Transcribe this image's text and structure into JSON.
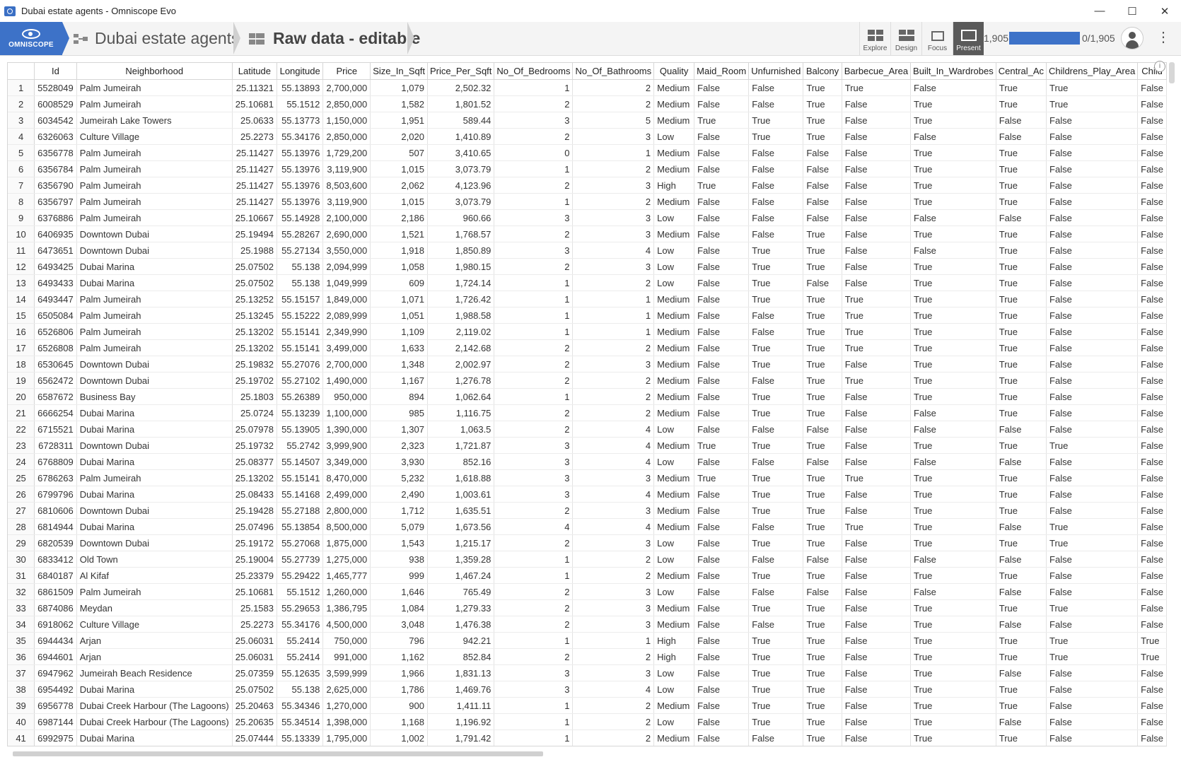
{
  "window": {
    "title": "Dubai estate agents - Omniscope Evo",
    "minimize": "—",
    "maximize": "☐",
    "close": "✕"
  },
  "toolbar": {
    "logo_label": "OMNISCOPE",
    "breadcrumb_project": "Dubai estate agents",
    "breadcrumb_view": "Raw data - editable",
    "modes": [
      "Explore",
      "Design",
      "Focus",
      "Present"
    ],
    "active_mode": "Present",
    "record_count_left": "1,905",
    "progress_fraction": 1.0,
    "record_count_right": "0/1,905",
    "accent_color": "#3d72c8"
  },
  "table": {
    "columns": [
      "Id",
      "Neighborhood",
      "Latitude",
      "Longitude",
      "Price",
      "Size_In_Sqft",
      "Price_Per_Sqft",
      "No_Of_Bedrooms",
      "No_Of_Bathrooms",
      "Quality",
      "Maid_Room",
      "Unfurnished",
      "Balcony",
      "Barbecue_Area",
      "Built_In_Wardrobes",
      "Central_Ac",
      "Childrens_Play_Area",
      "Child"
    ],
    "rows": [
      [
        "1",
        "5528049",
        "Palm Jumeirah",
        "25.11321",
        "55.13893",
        "2,700,000",
        "1,079",
        "2,502.32",
        "1",
        "2",
        "Medium",
        "False",
        "False",
        "True",
        "True",
        "False",
        "True",
        "True",
        "False"
      ],
      [
        "2",
        "6008529",
        "Palm Jumeirah",
        "25.10681",
        "55.1512",
        "2,850,000",
        "1,582",
        "1,801.52",
        "2",
        "2",
        "Medium",
        "False",
        "False",
        "True",
        "False",
        "True",
        "True",
        "True",
        "False"
      ],
      [
        "3",
        "6034542",
        "Jumeirah Lake Towers",
        "25.0633",
        "55.13773",
        "1,150,000",
        "1,951",
        "589.44",
        "3",
        "5",
        "Medium",
        "True",
        "True",
        "True",
        "False",
        "True",
        "False",
        "False",
        "False"
      ],
      [
        "4",
        "6326063",
        "Culture Village",
        "25.2273",
        "55.34176",
        "2,850,000",
        "2,020",
        "1,410.89",
        "2",
        "3",
        "Low",
        "False",
        "True",
        "True",
        "False",
        "False",
        "False",
        "False",
        "False"
      ],
      [
        "5",
        "6356778",
        "Palm Jumeirah",
        "25.11427",
        "55.13976",
        "1,729,200",
        "507",
        "3,410.65",
        "0",
        "1",
        "Medium",
        "False",
        "False",
        "False",
        "False",
        "True",
        "True",
        "False",
        "False"
      ],
      [
        "6",
        "6356784",
        "Palm Jumeirah",
        "25.11427",
        "55.13976",
        "3,119,900",
        "1,015",
        "3,073.79",
        "1",
        "2",
        "Medium",
        "False",
        "False",
        "False",
        "False",
        "True",
        "True",
        "False",
        "False"
      ],
      [
        "7",
        "6356790",
        "Palm Jumeirah",
        "25.11427",
        "55.13976",
        "8,503,600",
        "2,062",
        "4,123.96",
        "2",
        "3",
        "High",
        "True",
        "False",
        "False",
        "False",
        "True",
        "True",
        "False",
        "False"
      ],
      [
        "8",
        "6356797",
        "Palm Jumeirah",
        "25.11427",
        "55.13976",
        "3,119,900",
        "1,015",
        "3,073.79",
        "1",
        "2",
        "Medium",
        "False",
        "False",
        "False",
        "False",
        "True",
        "True",
        "False",
        "False"
      ],
      [
        "9",
        "6376886",
        "Palm Jumeirah",
        "25.10667",
        "55.14928",
        "2,100,000",
        "2,186",
        "960.66",
        "3",
        "3",
        "Low",
        "False",
        "False",
        "False",
        "False",
        "False",
        "False",
        "False",
        "False"
      ],
      [
        "10",
        "6406935",
        "Downtown Dubai",
        "25.19494",
        "55.28267",
        "2,690,000",
        "1,521",
        "1,768.57",
        "2",
        "3",
        "Medium",
        "False",
        "False",
        "True",
        "False",
        "True",
        "True",
        "False",
        "False"
      ],
      [
        "11",
        "6473651",
        "Downtown Dubai",
        "25.1988",
        "55.27134",
        "3,550,000",
        "1,918",
        "1,850.89",
        "3",
        "4",
        "Low",
        "False",
        "True",
        "True",
        "False",
        "False",
        "True",
        "False",
        "False"
      ],
      [
        "12",
        "6493425",
        "Dubai Marina",
        "25.07502",
        "55.138",
        "2,094,999",
        "1,058",
        "1,980.15",
        "2",
        "3",
        "Low",
        "False",
        "True",
        "True",
        "False",
        "True",
        "True",
        "False",
        "False"
      ],
      [
        "13",
        "6493433",
        "Dubai Marina",
        "25.07502",
        "55.138",
        "1,049,999",
        "609",
        "1,724.14",
        "1",
        "2",
        "Low",
        "False",
        "True",
        "False",
        "False",
        "True",
        "True",
        "False",
        "False"
      ],
      [
        "14",
        "6493447",
        "Palm Jumeirah",
        "25.13252",
        "55.15157",
        "1,849,000",
        "1,071",
        "1,726.42",
        "1",
        "1",
        "Medium",
        "False",
        "True",
        "True",
        "True",
        "True",
        "True",
        "False",
        "False"
      ],
      [
        "15",
        "6505084",
        "Palm Jumeirah",
        "25.13245",
        "55.15222",
        "2,089,999",
        "1,051",
        "1,988.58",
        "1",
        "1",
        "Medium",
        "False",
        "False",
        "True",
        "True",
        "True",
        "True",
        "False",
        "False"
      ],
      [
        "16",
        "6526806",
        "Palm Jumeirah",
        "25.13202",
        "55.15141",
        "2,349,990",
        "1,109",
        "2,119.02",
        "1",
        "1",
        "Medium",
        "False",
        "False",
        "True",
        "True",
        "True",
        "True",
        "False",
        "False"
      ],
      [
        "17",
        "6526808",
        "Palm Jumeirah",
        "25.13202",
        "55.15141",
        "3,499,000",
        "1,633",
        "2,142.68",
        "2",
        "2",
        "Medium",
        "False",
        "True",
        "True",
        "True",
        "True",
        "True",
        "False",
        "False"
      ],
      [
        "18",
        "6530645",
        "Downtown Dubai",
        "25.19832",
        "55.27076",
        "2,700,000",
        "1,348",
        "2,002.97",
        "2",
        "3",
        "Medium",
        "False",
        "True",
        "True",
        "False",
        "True",
        "True",
        "False",
        "False"
      ],
      [
        "19",
        "6562472",
        "Downtown Dubai",
        "25.19702",
        "55.27102",
        "1,490,000",
        "1,167",
        "1,276.78",
        "2",
        "2",
        "Medium",
        "False",
        "False",
        "True",
        "True",
        "True",
        "True",
        "False",
        "False"
      ],
      [
        "20",
        "6587672",
        "Business Bay",
        "25.1803",
        "55.26389",
        "950,000",
        "894",
        "1,062.64",
        "1",
        "2",
        "Medium",
        "False",
        "True",
        "True",
        "False",
        "True",
        "True",
        "False",
        "False"
      ],
      [
        "21",
        "6666254",
        "Dubai Marina",
        "25.0724",
        "55.13239",
        "1,100,000",
        "985",
        "1,116.75",
        "2",
        "2",
        "Medium",
        "False",
        "True",
        "True",
        "False",
        "False",
        "True",
        "False",
        "False"
      ],
      [
        "22",
        "6715521",
        "Dubai Marina",
        "25.07978",
        "55.13905",
        "1,390,000",
        "1,307",
        "1,063.5",
        "2",
        "4",
        "Low",
        "False",
        "False",
        "False",
        "False",
        "False",
        "False",
        "False",
        "False"
      ],
      [
        "23",
        "6728311",
        "Downtown Dubai",
        "25.19732",
        "55.2742",
        "3,999,900",
        "2,323",
        "1,721.87",
        "3",
        "4",
        "Medium",
        "True",
        "True",
        "True",
        "False",
        "True",
        "True",
        "True",
        "False"
      ],
      [
        "24",
        "6768809",
        "Dubai Marina",
        "25.08377",
        "55.14507",
        "3,349,000",
        "3,930",
        "852.16",
        "3",
        "4",
        "Low",
        "False",
        "False",
        "False",
        "False",
        "False",
        "False",
        "False",
        "False"
      ],
      [
        "25",
        "6786263",
        "Palm Jumeirah",
        "25.13202",
        "55.15141",
        "8,470,000",
        "5,232",
        "1,618.88",
        "3",
        "3",
        "Medium",
        "True",
        "True",
        "True",
        "True",
        "True",
        "True",
        "False",
        "False"
      ],
      [
        "26",
        "6799796",
        "Dubai Marina",
        "25.08433",
        "55.14168",
        "2,499,000",
        "2,490",
        "1,003.61",
        "3",
        "4",
        "Medium",
        "False",
        "True",
        "True",
        "False",
        "True",
        "True",
        "False",
        "False"
      ],
      [
        "27",
        "6810606",
        "Downtown Dubai",
        "25.19428",
        "55.27188",
        "2,800,000",
        "1,712",
        "1,635.51",
        "2",
        "3",
        "Medium",
        "False",
        "True",
        "True",
        "False",
        "True",
        "True",
        "False",
        "False"
      ],
      [
        "28",
        "6814944",
        "Dubai Marina",
        "25.07496",
        "55.13854",
        "8,500,000",
        "5,079",
        "1,673.56",
        "4",
        "4",
        "Medium",
        "False",
        "False",
        "True",
        "True",
        "True",
        "False",
        "True",
        "False"
      ],
      [
        "29",
        "6820539",
        "Downtown Dubai",
        "25.19172",
        "55.27068",
        "1,875,000",
        "1,543",
        "1,215.17",
        "2",
        "3",
        "Low",
        "False",
        "True",
        "True",
        "False",
        "True",
        "True",
        "True",
        "False"
      ],
      [
        "30",
        "6833412",
        "Old Town",
        "25.19004",
        "55.27739",
        "1,275,000",
        "938",
        "1,359.28",
        "1",
        "2",
        "Low",
        "False",
        "False",
        "False",
        "False",
        "False",
        "False",
        "False",
        "False"
      ],
      [
        "31",
        "6840187",
        "Al Kifaf",
        "25.23379",
        "55.29422",
        "1,465,777",
        "999",
        "1,467.24",
        "1",
        "2",
        "Medium",
        "False",
        "True",
        "True",
        "False",
        "True",
        "True",
        "False",
        "False"
      ],
      [
        "32",
        "6861509",
        "Palm Jumeirah",
        "25.10681",
        "55.1512",
        "1,260,000",
        "1,646",
        "765.49",
        "2",
        "3",
        "Low",
        "False",
        "False",
        "False",
        "False",
        "False",
        "False",
        "False",
        "False"
      ],
      [
        "33",
        "6874086",
        "Meydan",
        "25.1583",
        "55.29653",
        "1,386,795",
        "1,084",
        "1,279.33",
        "2",
        "3",
        "Medium",
        "False",
        "True",
        "True",
        "False",
        "True",
        "True",
        "True",
        "False"
      ],
      [
        "34",
        "6918062",
        "Culture Village",
        "25.2273",
        "55.34176",
        "4,500,000",
        "3,048",
        "1,476.38",
        "2",
        "3",
        "Medium",
        "False",
        "False",
        "True",
        "False",
        "True",
        "False",
        "False",
        "False"
      ],
      [
        "35",
        "6944434",
        "Arjan",
        "25.06031",
        "55.2414",
        "750,000",
        "796",
        "942.21",
        "1",
        "1",
        "High",
        "False",
        "True",
        "True",
        "False",
        "True",
        "True",
        "True",
        "True"
      ],
      [
        "36",
        "6944601",
        "Arjan",
        "25.06031",
        "55.2414",
        "991,000",
        "1,162",
        "852.84",
        "2",
        "2",
        "High",
        "False",
        "True",
        "True",
        "False",
        "True",
        "True",
        "True",
        "True"
      ],
      [
        "37",
        "6947962",
        "Jumeirah Beach Residence",
        "25.07359",
        "55.12635",
        "3,599,999",
        "1,966",
        "1,831.13",
        "3",
        "3",
        "Low",
        "False",
        "True",
        "True",
        "False",
        "True",
        "False",
        "False",
        "False"
      ],
      [
        "38",
        "6954492",
        "Dubai Marina",
        "25.07502",
        "55.138",
        "2,625,000",
        "1,786",
        "1,469.76",
        "3",
        "4",
        "Low",
        "False",
        "True",
        "True",
        "False",
        "True",
        "True",
        "False",
        "False"
      ],
      [
        "39",
        "6956778",
        "Dubai Creek Harbour (The Lagoons)",
        "25.20463",
        "55.34346",
        "1,270,000",
        "900",
        "1,411.11",
        "1",
        "2",
        "Medium",
        "False",
        "True",
        "True",
        "False",
        "True",
        "True",
        "False",
        "False"
      ],
      [
        "40",
        "6987144",
        "Dubai Creek Harbour (The Lagoons)",
        "25.20635",
        "55.34514",
        "1,398,000",
        "1,168",
        "1,196.92",
        "1",
        "2",
        "Low",
        "False",
        "True",
        "True",
        "False",
        "True",
        "False",
        "False",
        "False"
      ],
      [
        "41",
        "6992975",
        "Dubai Marina",
        "25.07444",
        "55.13339",
        "1,795,000",
        "1,002",
        "1,791.42",
        "1",
        "2",
        "Medium",
        "False",
        "False",
        "True",
        "False",
        "True",
        "True",
        "False",
        "False"
      ]
    ]
  }
}
